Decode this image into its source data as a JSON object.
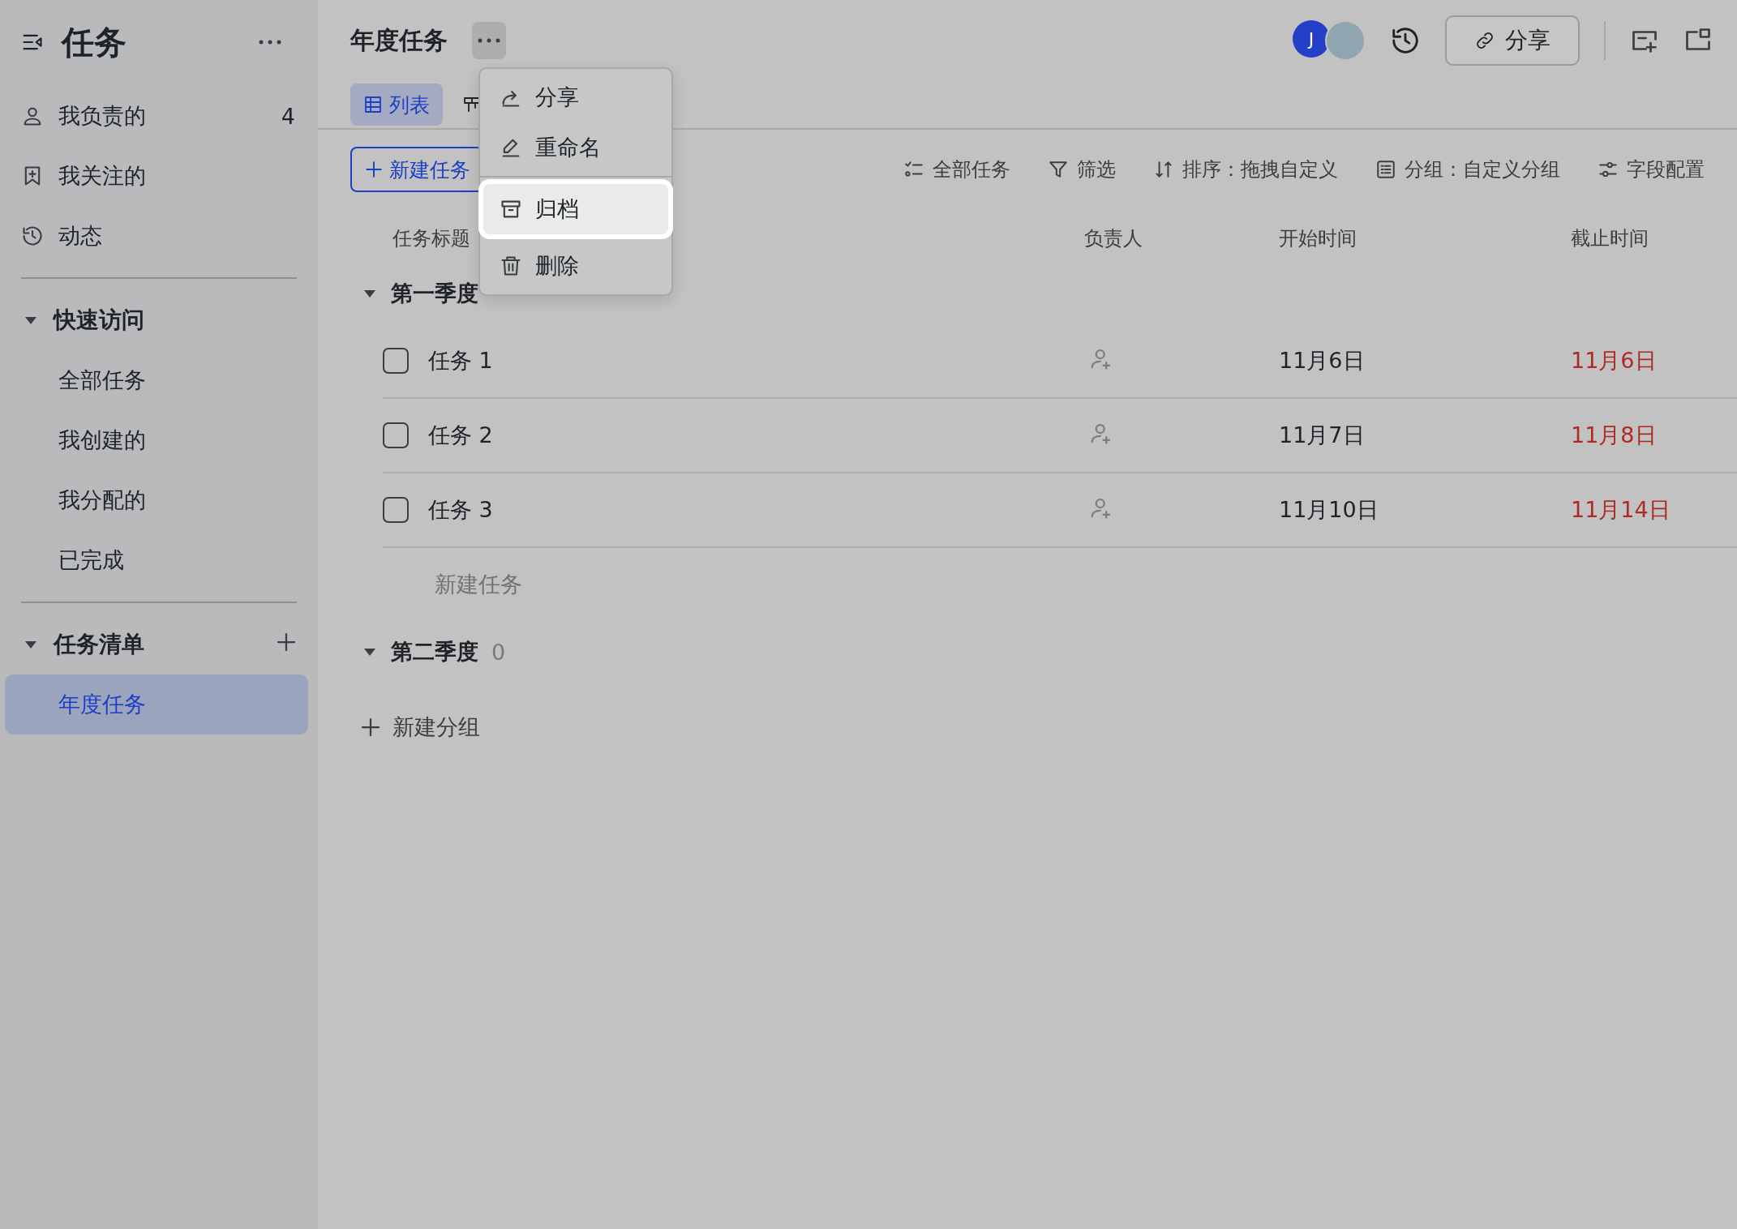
{
  "sidebar": {
    "title": "任务",
    "nav": [
      {
        "label": "我负责的",
        "kind": "person",
        "count": "4"
      },
      {
        "label": "我关注的",
        "kind": "bookmark"
      },
      {
        "label": "动态",
        "kind": "history"
      }
    ],
    "sections": [
      {
        "title": "快速访问",
        "expanded": true,
        "addable": false,
        "items": [
          {
            "label": "全部任务",
            "selected": false
          },
          {
            "label": "我创建的",
            "selected": false
          },
          {
            "label": "我分配的",
            "selected": false
          },
          {
            "label": "已完成",
            "selected": false
          }
        ]
      },
      {
        "title": "任务清单",
        "expanded": true,
        "addable": true,
        "items": [
          {
            "label": "年度任务",
            "selected": true
          }
        ]
      }
    ]
  },
  "header": {
    "title": "年度任务",
    "avatar_letter": "J",
    "share_button": "分享"
  },
  "tabs": [
    {
      "kind": "list",
      "label": "列表",
      "selected": true
    },
    {
      "kind": "board",
      "selected": false
    }
  ],
  "menu": [
    {
      "kind": "share",
      "label": "分享",
      "highlighted": false
    },
    {
      "kind": "rename",
      "label": "重命名",
      "highlighted": false
    },
    {
      "kind": "archive",
      "label": "归档",
      "highlighted": true
    },
    {
      "kind": "delete",
      "label": "删除",
      "highlighted": false
    }
  ],
  "toolbar": {
    "new_task_button": "新建任务",
    "actions": [
      {
        "kind": "checklist",
        "label": "全部任务"
      },
      {
        "kind": "filter",
        "label": "筛选"
      },
      {
        "kind": "sort",
        "label": "排序：拖拽自定义"
      },
      {
        "kind": "group",
        "label": "分组：自定义分组"
      },
      {
        "kind": "fields",
        "label": "字段配置"
      }
    ]
  },
  "table": {
    "columns": [
      "任务标题",
      "负责人",
      "开始时间",
      "截止时间"
    ],
    "groups": [
      {
        "name": "第一季度",
        "expanded": true,
        "rows": [
          {
            "title": "任务 1",
            "checked": false,
            "start": "11月6日",
            "due": "11月6日",
            "overdue": true
          },
          {
            "title": "任务 2",
            "checked": false,
            "start": "11月7日",
            "due": "11月8日",
            "overdue": true
          },
          {
            "title": "任务 3",
            "checked": false,
            "start": "11月10日",
            "due": "11月14日",
            "overdue": true
          }
        ],
        "new_task": "新建任务"
      },
      {
        "name": "第二季度",
        "count": "0",
        "expanded": true
      }
    ],
    "new_group": "新建分组"
  }
}
